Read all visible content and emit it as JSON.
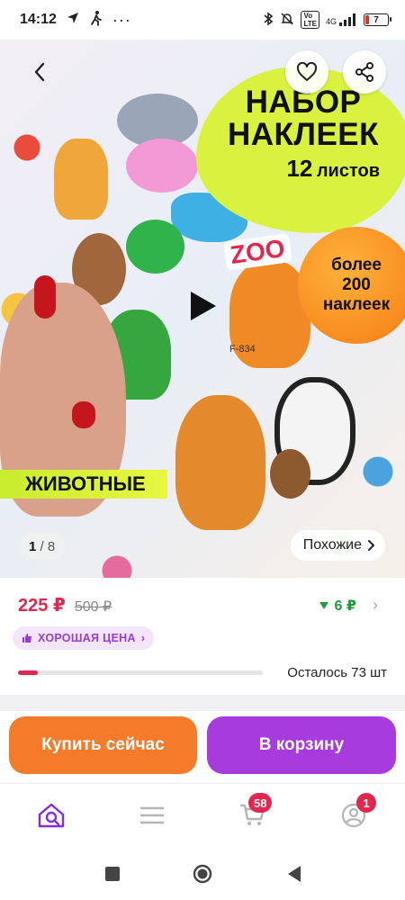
{
  "status_bar": {
    "time": "14:12",
    "network": "4G",
    "battery": "7"
  },
  "hero": {
    "promo_title_line1": "НАБОР",
    "promo_title_line2": "НАКЛЕЕК",
    "promo_count": "12",
    "promo_count_unit": "листов",
    "badge_line1": "более",
    "badge_line2": "200",
    "badge_line3": "наклеек",
    "animals_label": "ЖИВОТНЫЕ",
    "zoo_label": "ZOO",
    "code_label": "F-834",
    "counter_current": "1",
    "counter_sep": "/ 8",
    "similar_label": "Похожие"
  },
  "price": {
    "current": "225 ₽",
    "old": "500 ₽",
    "cashback": "6 ₽",
    "good_price_label": "ХОРОШАЯ ЦЕНА",
    "stock_text": "Осталось 73 шт",
    "stock_fraction": 0.08
  },
  "actions": {
    "buy_now": "Купить сейчас",
    "add_to_cart": "В корзину"
  },
  "bottom_nav": {
    "cart_badge": "58",
    "profile_badge": "1"
  },
  "colors": {
    "price": "#e3264d",
    "buy_button": "#f37b2a",
    "cart_button": "#a73bdd",
    "good_price_text": "#9b3bd8",
    "cashback": "#1e9c3c"
  }
}
